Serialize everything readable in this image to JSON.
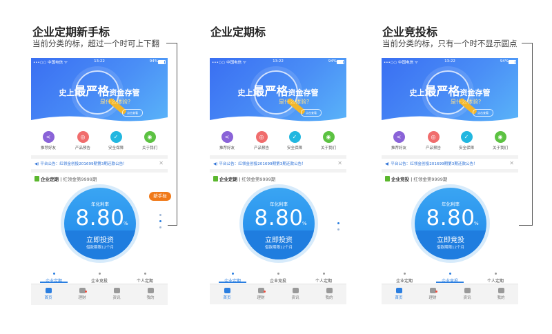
{
  "panels": [
    {
      "title": "企业定期新手标",
      "subtitle": "当前分类的标，超过一个时可上下翻",
      "section_name": "企业定期",
      "section_sub": "红领金第9999期",
      "rate_label": "年化利率",
      "rate": "8.80",
      "pct": "%",
      "button": "立即投资",
      "term": "借款期限12个月",
      "badge": "新手标",
      "active_tab": 0
    },
    {
      "title": "企业定期标",
      "subtitle": "",
      "section_name": "企业定期",
      "section_sub": "红领金第9999期",
      "rate_label": "年化利率",
      "rate": "8.80",
      "pct": "%",
      "button": "立即投资",
      "term": "借款期限12个月",
      "badge": "",
      "active_tab": 0
    },
    {
      "title": "企业竞投标",
      "subtitle": "当前分类的标，只有一个时不显示圆点",
      "section_name": "企业竞投",
      "section_sub": "红领金第9999期",
      "rate_label": "年化利率",
      "rate": "8.80",
      "pct": "%",
      "button": "立即竞投",
      "term": "借款期限12个月",
      "badge": "",
      "active_tab": 1
    }
  ],
  "status_bar": {
    "carrier": "•••○○ 中国电信 ᯤ",
    "time": "13:22",
    "battery": "94%"
  },
  "banner": {
    "slogan_1": "史上",
    "slogan_2": "最严格",
    "slogan_3": "资金存管",
    "sub": "是什么体验?",
    "try_label": "点击查看"
  },
  "menu": [
    {
      "label": "推荐好友",
      "icon": "share-icon",
      "color": "#8a63d8",
      "glyph": "<"
    },
    {
      "label": "产品预告",
      "icon": "clock-icon",
      "color": "#f06d6d",
      "glyph": "◎"
    },
    {
      "label": "安全保障",
      "icon": "shield-icon",
      "color": "#22b7e0",
      "glyph": "✓"
    },
    {
      "label": "关于我们",
      "icon": "people-icon",
      "color": "#5cc242",
      "glyph": "◉"
    }
  ],
  "notice": {
    "icon": "speaker-icon",
    "text": "平台公告：红领金创投201699期第3期还款公告！"
  },
  "tabs": [
    "企业定期",
    "企业竞投",
    "个人定期"
  ],
  "bottom_nav": [
    {
      "label": "首页",
      "icon": "home-icon"
    },
    {
      "label": "理财",
      "icon": "finance-icon"
    },
    {
      "label": "资讯",
      "icon": "news-icon"
    },
    {
      "label": "我的",
      "icon": "user-icon"
    }
  ],
  "colors": {
    "primary": "#2a7ee0",
    "badge": "#f07a1a",
    "circle": "#1f88ea"
  }
}
